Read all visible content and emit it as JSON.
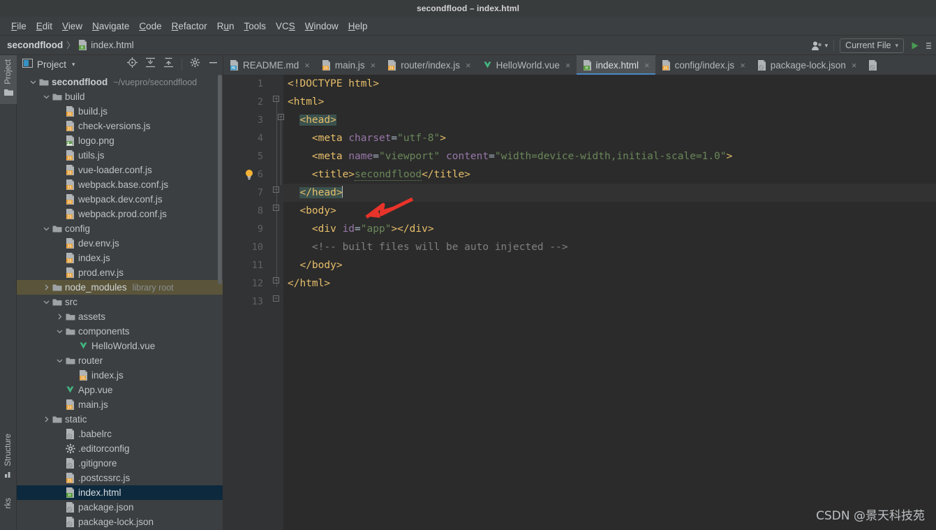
{
  "window": {
    "title": "secondflood – index.html"
  },
  "menubar": {
    "items": [
      {
        "label": "File",
        "mnemonic": "F"
      },
      {
        "label": "Edit",
        "mnemonic": "E"
      },
      {
        "label": "View",
        "mnemonic": "V"
      },
      {
        "label": "Navigate",
        "mnemonic": "N"
      },
      {
        "label": "Code",
        "mnemonic": "C"
      },
      {
        "label": "Refactor",
        "mnemonic": "R"
      },
      {
        "label": "Run",
        "mnemonic": "u"
      },
      {
        "label": "Tools",
        "mnemonic": "T"
      },
      {
        "label": "VCS",
        "mnemonic": "S"
      },
      {
        "label": "Window",
        "mnemonic": "W"
      },
      {
        "label": "Help",
        "mnemonic": "H"
      }
    ]
  },
  "navbar": {
    "crumbs": [
      "secondflood",
      "index.html"
    ],
    "separator": "〉",
    "run_config": "Current File",
    "icons": {
      "user": "user-icon",
      "chevron": "▾",
      "run": "run-icon",
      "more": "more-icon"
    }
  },
  "toolstrip": {
    "tabs": [
      {
        "label": "Project",
        "active": true
      },
      {
        "label": "Structure",
        "active": false
      },
      {
        "label": "rks",
        "active": false
      }
    ]
  },
  "project_panel": {
    "title": "Project",
    "icons": [
      "locate-icon",
      "expand-all-icon",
      "collapse-all-icon",
      "settings-gear-icon",
      "minimize-icon"
    ],
    "tree": [
      {
        "indent": 0,
        "twisty": "down",
        "icon": "folder",
        "label": "secondflood",
        "bold": true,
        "sub": "~/vuepro/secondflood"
      },
      {
        "indent": 1,
        "twisty": "down",
        "icon": "folder",
        "label": "build"
      },
      {
        "indent": 2,
        "twisty": "",
        "icon": "js",
        "label": "build.js"
      },
      {
        "indent": 2,
        "twisty": "",
        "icon": "js",
        "label": "check-versions.js"
      },
      {
        "indent": 2,
        "twisty": "",
        "icon": "png",
        "label": "logo.png"
      },
      {
        "indent": 2,
        "twisty": "",
        "icon": "js",
        "label": "utils.js"
      },
      {
        "indent": 2,
        "twisty": "",
        "icon": "js",
        "label": "vue-loader.conf.js"
      },
      {
        "indent": 2,
        "twisty": "",
        "icon": "js",
        "label": "webpack.base.conf.js"
      },
      {
        "indent": 2,
        "twisty": "",
        "icon": "js",
        "label": "webpack.dev.conf.js"
      },
      {
        "indent": 2,
        "twisty": "",
        "icon": "js",
        "label": "webpack.prod.conf.js"
      },
      {
        "indent": 1,
        "twisty": "down",
        "icon": "folder",
        "label": "config"
      },
      {
        "indent": 2,
        "twisty": "",
        "icon": "js",
        "label": "dev.env.js"
      },
      {
        "indent": 2,
        "twisty": "",
        "icon": "js",
        "label": "index.js"
      },
      {
        "indent": 2,
        "twisty": "",
        "icon": "js",
        "label": "prod.env.js"
      },
      {
        "indent": 1,
        "twisty": "right",
        "icon": "folder",
        "label": "node_modules",
        "sub": "library root",
        "libroot": true
      },
      {
        "indent": 1,
        "twisty": "down",
        "icon": "folder",
        "label": "src"
      },
      {
        "indent": 2,
        "twisty": "right",
        "icon": "folder",
        "label": "assets"
      },
      {
        "indent": 2,
        "twisty": "down",
        "icon": "folder",
        "label": "components"
      },
      {
        "indent": 3,
        "twisty": "",
        "icon": "vue",
        "label": "HelloWorld.vue"
      },
      {
        "indent": 2,
        "twisty": "down",
        "icon": "folder",
        "label": "router"
      },
      {
        "indent": 3,
        "twisty": "",
        "icon": "js",
        "label": "index.js"
      },
      {
        "indent": 2,
        "twisty": "",
        "icon": "vue",
        "label": "App.vue"
      },
      {
        "indent": 2,
        "twisty": "",
        "icon": "js",
        "label": "main.js"
      },
      {
        "indent": 1,
        "twisty": "right",
        "icon": "folder",
        "label": "static"
      },
      {
        "indent": 2,
        "twisty": "",
        "icon": "json",
        "label": ".babelrc"
      },
      {
        "indent": 2,
        "twisty": "",
        "icon": "config",
        "label": ".editorconfig"
      },
      {
        "indent": 2,
        "twisty": "",
        "icon": "ignore",
        "label": ".gitignore"
      },
      {
        "indent": 2,
        "twisty": "",
        "icon": "js",
        "label": ".postcssrc.js"
      },
      {
        "indent": 2,
        "twisty": "",
        "icon": "html",
        "label": "index.html",
        "selected": true
      },
      {
        "indent": 2,
        "twisty": "",
        "icon": "json",
        "label": "package.json"
      },
      {
        "indent": 2,
        "twisty": "",
        "icon": "json",
        "label": "package-lock.json"
      }
    ]
  },
  "editor": {
    "tabs": [
      {
        "label": "README.md",
        "icon": "md",
        "active": false,
        "close": "×"
      },
      {
        "label": "main.js",
        "icon": "js",
        "active": false,
        "close": "×"
      },
      {
        "label": "router/index.js",
        "icon": "js",
        "active": false,
        "close": "×"
      },
      {
        "label": "HelloWorld.vue",
        "icon": "vue",
        "active": false,
        "close": "×"
      },
      {
        "label": "index.html",
        "icon": "html",
        "active": true,
        "close": "×"
      },
      {
        "label": "config/index.js",
        "icon": "js",
        "active": false,
        "close": "×"
      },
      {
        "label": "package-lock.json",
        "icon": "json",
        "active": false,
        "close": "×"
      },
      {
        "label": "",
        "icon": "json",
        "active": false,
        "close": ""
      }
    ],
    "line_numbers": [
      "1",
      "2",
      "3",
      "4",
      "5",
      "6",
      "7",
      "8",
      "9",
      "10",
      "11",
      "12",
      "13"
    ],
    "lines": [
      {
        "n": 1,
        "text": "<!DOCTYPE html>"
      },
      {
        "n": 2,
        "text": "<html>"
      },
      {
        "n": 3,
        "text": "  <head>"
      },
      {
        "n": 4,
        "text": "    <meta charset=\"utf-8\">"
      },
      {
        "n": 5,
        "text": "    <meta name=\"viewport\" content=\"width=device-width,initial-scale=1.0\">"
      },
      {
        "n": 6,
        "text": "    <title>secondflood</title>"
      },
      {
        "n": 7,
        "text": "  </head>"
      },
      {
        "n": 8,
        "text": "  <body>"
      },
      {
        "n": 9,
        "text": "    <div id=\"app\"></div>"
      },
      {
        "n": 10,
        "text": "    <!-- built files will be auto injected -->"
      },
      {
        "n": 11,
        "text": "  </body>"
      },
      {
        "n": 12,
        "text": "</html>"
      },
      {
        "n": 13,
        "text": ""
      }
    ],
    "caret_line": 7,
    "title_text": "secondflood",
    "comment_text": "<!-- built files will be auto injected -->"
  },
  "annotation": {
    "arrow_color": "#e8332a"
  },
  "watermark": {
    "text": "CSDN @景天科技苑"
  },
  "colors": {
    "tag": "#e8bf6a",
    "attr": "#9876aa",
    "string": "#6a8759",
    "comment": "#808080",
    "selection": "#0d293e",
    "tab_underline": "#4a88c7",
    "library_root": "#5a553a",
    "run_green": "#499c54"
  }
}
